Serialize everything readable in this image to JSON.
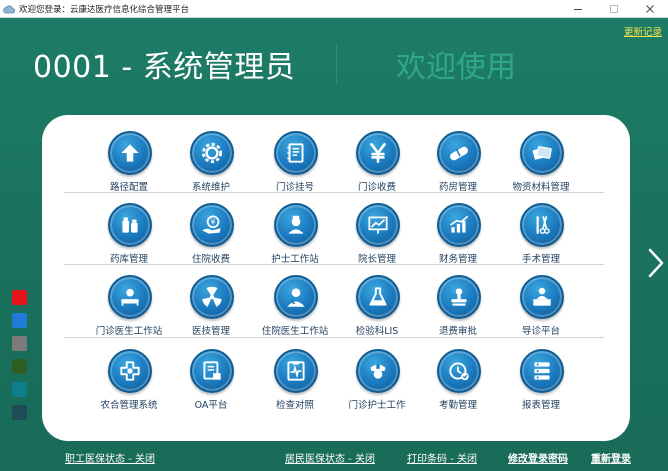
{
  "window": {
    "title": "欢迎您登录：云康达医疗信息化综合管理平台"
  },
  "header": {
    "update_log": "更新记录",
    "user_label": "0001 - 系统管理员",
    "welcome": "欢迎使用"
  },
  "modules": [
    {
      "label": "路径配置",
      "icon": "upload-arrow-icon"
    },
    {
      "label": "系统维护",
      "icon": "gear-icon"
    },
    {
      "label": "门诊挂号",
      "icon": "notebook-icon"
    },
    {
      "label": "门诊收费",
      "icon": "yen-icon"
    },
    {
      "label": "药房管理",
      "icon": "pill-icon"
    },
    {
      "label": "物资材料管理",
      "icon": "cards-icon"
    },
    {
      "label": "药库管理",
      "icon": "medicine-bottles-icon"
    },
    {
      "label": "住院收费",
      "icon": "yen-hand-icon"
    },
    {
      "label": "护士工作站",
      "icon": "nurse-icon"
    },
    {
      "label": "院长管理",
      "icon": "presentation-chart-icon"
    },
    {
      "label": "财务管理",
      "icon": "finance-chart-icon"
    },
    {
      "label": "手术管理",
      "icon": "surgical-tools-icon"
    },
    {
      "label": "门诊医生工作站",
      "icon": "doctor-bed-icon"
    },
    {
      "label": "医技管理",
      "icon": "radiation-icon"
    },
    {
      "label": "住院医生工作站",
      "icon": "doctor-icon"
    },
    {
      "label": "检验科LIS",
      "icon": "lab-flask-icon"
    },
    {
      "label": "退费审批",
      "icon": "stamp-icon"
    },
    {
      "label": "导诊平台",
      "icon": "reception-desk-icon"
    },
    {
      "label": "农合管理系统",
      "icon": "medical-cross-icon"
    },
    {
      "label": "OA平台",
      "icon": "oa-document-icon"
    },
    {
      "label": "检查对照",
      "icon": "ecg-clipboard-icon"
    },
    {
      "label": "门诊护士工作",
      "icon": "nurse-cap-icon"
    },
    {
      "label": "考勤管理",
      "icon": "clock-check-icon"
    },
    {
      "label": "报表管理",
      "icon": "report-list-icon"
    }
  ],
  "swatches": [
    "#e8141c",
    "#1f7bd6",
    "#7b7b7b",
    "#2e5e22",
    "#0e7e8c",
    "#1e4c58"
  ],
  "footer": {
    "staff_insurance": "职工医保状态 - 关闭",
    "resident_insurance": "居民医保状态 - 关闭",
    "barcode": "打印条码 - 关闭",
    "change_password": "修改登录密码",
    "relogin": "重新登录"
  }
}
